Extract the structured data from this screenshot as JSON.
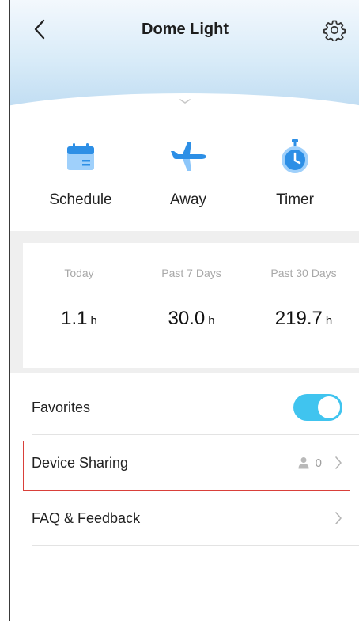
{
  "header": {
    "title": "Dome Light"
  },
  "features": [
    {
      "label": "Schedule",
      "icon": "calendar-icon"
    },
    {
      "label": "Away",
      "icon": "airplane-icon"
    },
    {
      "label": "Timer",
      "icon": "stopwatch-icon"
    }
  ],
  "stats": [
    {
      "caption": "Today",
      "value": "1.1",
      "unit": "h"
    },
    {
      "caption": "Past 7 Days",
      "value": "30.0",
      "unit": "h"
    },
    {
      "caption": "Past 30 Days",
      "value": "219.7",
      "unit": "h"
    }
  ],
  "settings": {
    "favorites": {
      "label": "Favorites",
      "enabled": true
    },
    "device_sharing": {
      "label": "Device Sharing",
      "count": "0"
    },
    "faq": {
      "label": "FAQ & Feedback"
    }
  },
  "colors": {
    "accent": "#40c4ef",
    "highlight": "#d9403a",
    "icon_blue": "#3aa0f0"
  }
}
